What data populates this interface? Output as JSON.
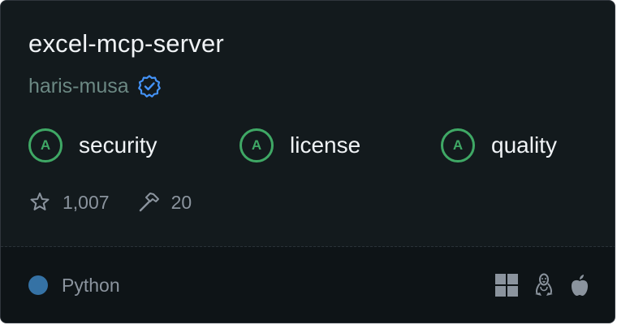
{
  "repo": {
    "name": "excel-mcp-server",
    "author": "haris-musa",
    "verified_icon": "verified-badge-icon"
  },
  "grades": [
    {
      "grade": "A",
      "label": "security"
    },
    {
      "grade": "A",
      "label": "license"
    },
    {
      "grade": "A",
      "label": "quality"
    }
  ],
  "stats": {
    "stars": "1,007",
    "star_icon": "star-icon",
    "tools": "20",
    "tools_icon": "hammer-icon"
  },
  "footer": {
    "language": "Python",
    "language_color": "#3572a5",
    "platforms": [
      "windows-icon",
      "linux-icon",
      "apple-icon"
    ]
  },
  "colors": {
    "background": "#131a1d",
    "grade_accent": "#3fa865",
    "verified_accent": "#4493f8"
  }
}
